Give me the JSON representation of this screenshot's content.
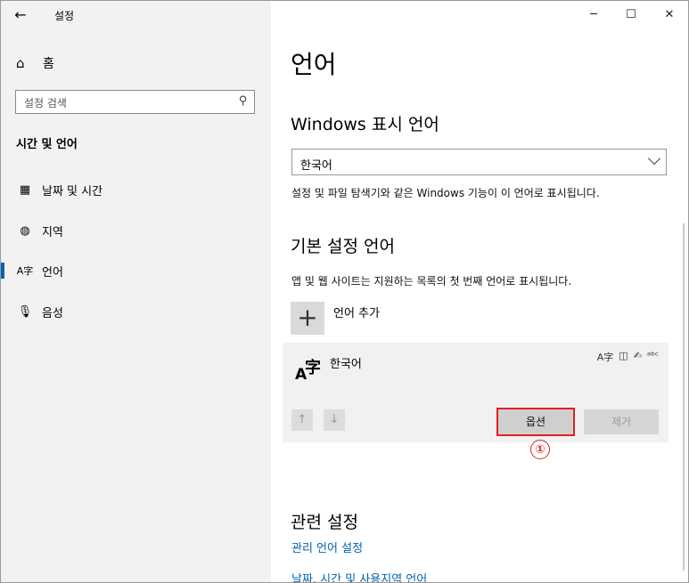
{
  "window": {
    "title": "설정",
    "back_glyph": "←",
    "minimize_glyph": "─",
    "maximize_glyph": "☐",
    "close_glyph": "✕"
  },
  "sidebar": {
    "home_label": "홈",
    "search_placeholder": "설정 검색",
    "section_title": "시간 및 언어",
    "items": [
      {
        "label": "날짜 및 시간",
        "icon": "calendar-clock-icon",
        "selected": false
      },
      {
        "label": "지역",
        "icon": "globe-icon",
        "selected": false
      },
      {
        "label": "언어",
        "icon": "language-icon",
        "selected": true
      },
      {
        "label": "음성",
        "icon": "microphone-icon",
        "selected": false
      }
    ]
  },
  "main": {
    "page_title": "언어",
    "display_language": {
      "heading": "Windows 표시 언어",
      "selected": "한국어",
      "description": "설정 및 파일 탐색기와 같은 Windows 기능이 이 언어로 표시됩니다."
    },
    "preferred": {
      "heading": "기본 설정 언어",
      "description": "앱 및 웹 사이트는 지원하는 목록의 첫 번째 언어로 표시됩니다.",
      "add_label": "언어 추가",
      "language_name": "한국어",
      "options_label": "옵션",
      "remove_label": "제거",
      "annotation": "①"
    },
    "related": {
      "heading": "관련 설정",
      "links": [
        "관리 언어 설정",
        "날짜, 시간 및 사용지역 언어"
      ]
    }
  },
  "colors": {
    "accent": "#0063b1",
    "highlight_frame": "#e02020"
  }
}
